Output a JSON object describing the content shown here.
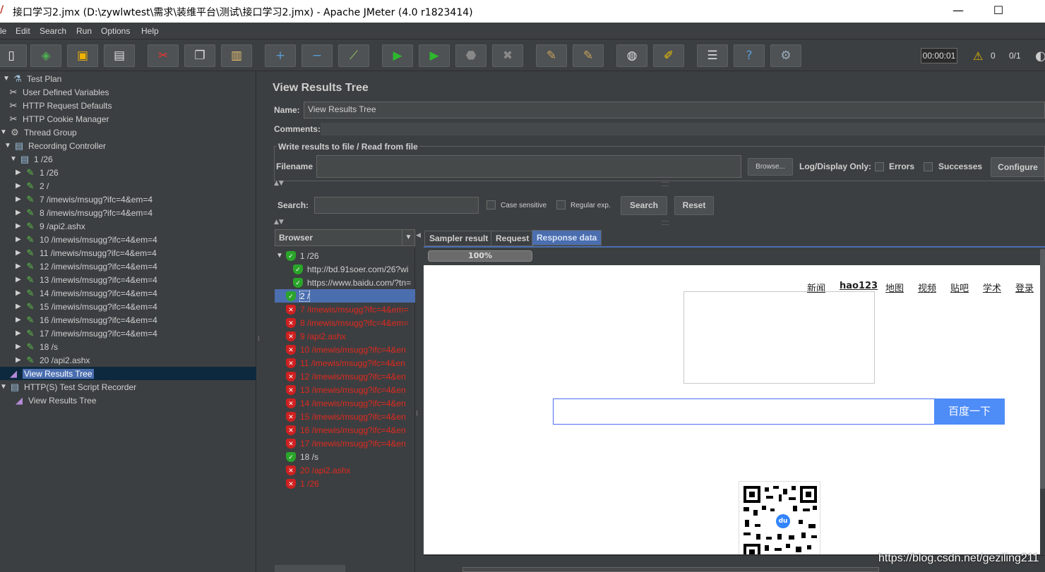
{
  "window": {
    "title": "接口学习2.jmx (D:\\zywlwtest\\需求\\装维平台\\测试\\接口学习2.jmx) - Apache JMeter (4.0 r1823414)",
    "minimize": "—",
    "maximize": "☐"
  },
  "menu": [
    "le",
    "Edit",
    "Search",
    "Run",
    "Options",
    "Help"
  ],
  "toolbar": {
    "timer": "00:00:01",
    "warnings": "0",
    "threads": "0/1"
  },
  "tree": {
    "nodes": [
      {
        "label": "Test Plan",
        "icon": "flask-icon"
      },
      {
        "label": "User Defined Variables",
        "icon": "wrench-icon"
      },
      {
        "label": "HTTP Request Defaults",
        "icon": "wrench-icon"
      },
      {
        "label": "HTTP Cookie Manager",
        "icon": "wrench-icon"
      },
      {
        "label": "Thread Group",
        "icon": "gear-icon"
      },
      {
        "label": "Recording Controller",
        "icon": "controller-icon"
      },
      {
        "label": "1 /26",
        "icon": "controller-icon"
      },
      {
        "label": "1 /26",
        "icon": "pipette-icon"
      },
      {
        "label": "2 /",
        "icon": "pipette-icon"
      },
      {
        "label": "7 /imewis/msugg?ifc=4&em=4",
        "icon": "pipette-icon"
      },
      {
        "label": "8 /imewis/msugg?ifc=4&em=4",
        "icon": "pipette-icon"
      },
      {
        "label": "9 /api2.ashx",
        "icon": "pipette-icon"
      },
      {
        "label": "10 /imewis/msugg?ifc=4&em=4",
        "icon": "pipette-icon"
      },
      {
        "label": "11 /imewis/msugg?ifc=4&em=4",
        "icon": "pipette-icon"
      },
      {
        "label": "12 /imewis/msugg?ifc=4&em=4",
        "icon": "pipette-icon"
      },
      {
        "label": "13 /imewis/msugg?ifc=4&em=4",
        "icon": "pipette-icon"
      },
      {
        "label": "14 /imewis/msugg?ifc=4&em=4",
        "icon": "pipette-icon"
      },
      {
        "label": "15 /imewis/msugg?ifc=4&em=4",
        "icon": "pipette-icon"
      },
      {
        "label": "16 /imewis/msugg?ifc=4&em=4",
        "icon": "pipette-icon"
      },
      {
        "label": "17 /imewis/msugg?ifc=4&em=4",
        "icon": "pipette-icon"
      },
      {
        "label": "18 /s",
        "icon": "pipette-icon"
      },
      {
        "label": "20 /api2.ashx",
        "icon": "pipette-icon"
      },
      {
        "label": "View Results Tree",
        "icon": "chart-icon"
      },
      {
        "label": "HTTP(S) Test Script Recorder",
        "icon": "recorder-icon"
      },
      {
        "label": "View Results Tree",
        "icon": "chart-icon"
      }
    ]
  },
  "panel": {
    "title": "View Results Tree",
    "name_label": "Name:",
    "name_value": "View Results Tree",
    "comments_label": "Comments:",
    "file_group_title": "Write results to file / Read from file",
    "filename_label": "Filename",
    "browse": "Browse...",
    "log_display": "Log/Display Only:",
    "errors": "Errors",
    "successes": "Successes",
    "configure": "Configure",
    "search_label": "Search:",
    "case_sensitive": "Case sensitive",
    "regular_exp": "Regular exp.",
    "search_btn": "Search",
    "reset_btn": "Reset",
    "renderer": "Browser",
    "tabs": [
      "Sampler result",
      "Request",
      "Response data"
    ],
    "progress": "100%"
  },
  "samples": [
    {
      "label": "1 /26",
      "status": "ok"
    },
    {
      "label": "http://bd.91soer.com/26?wi",
      "status": "ok"
    },
    {
      "label": "https://www.baidu.com/?tn=",
      "status": "ok"
    },
    {
      "label": "2 /",
      "status": "ok"
    },
    {
      "label": "7 /imewis/msugg?ifc=4&em=",
      "status": "err"
    },
    {
      "label": "8 /imewis/msugg?ifc=4&em=",
      "status": "err"
    },
    {
      "label": "9 /api2.ashx",
      "status": "err"
    },
    {
      "label": "10 /imewis/msugg?ifc=4&en",
      "status": "err"
    },
    {
      "label": "11 /imewis/msugg?ifc=4&en",
      "status": "err"
    },
    {
      "label": "12 /imewis/msugg?ifc=4&en",
      "status": "err"
    },
    {
      "label": "13 /imewis/msugg?ifc=4&en",
      "status": "err"
    },
    {
      "label": "14 /imewis/msugg?ifc=4&en",
      "status": "err"
    },
    {
      "label": "15 /imewis/msugg?ifc=4&en",
      "status": "err"
    },
    {
      "label": "16 /imewis/msugg?ifc=4&en",
      "status": "err"
    },
    {
      "label": "17 /imewis/msugg?ifc=4&en",
      "status": "err"
    },
    {
      "label": "18 /s",
      "status": "ok"
    },
    {
      "label": "20 /api2.ashx",
      "status": "err"
    },
    {
      "label": "1 /26",
      "status": "err"
    }
  ],
  "baidu": {
    "links": [
      "新闻",
      "hao123",
      "地图",
      "视频",
      "贴吧",
      "学术",
      "登录"
    ],
    "search_button": "百度一下",
    "qr_logo": "du"
  },
  "watermark": "https://blog.csdn.net/geziling211"
}
